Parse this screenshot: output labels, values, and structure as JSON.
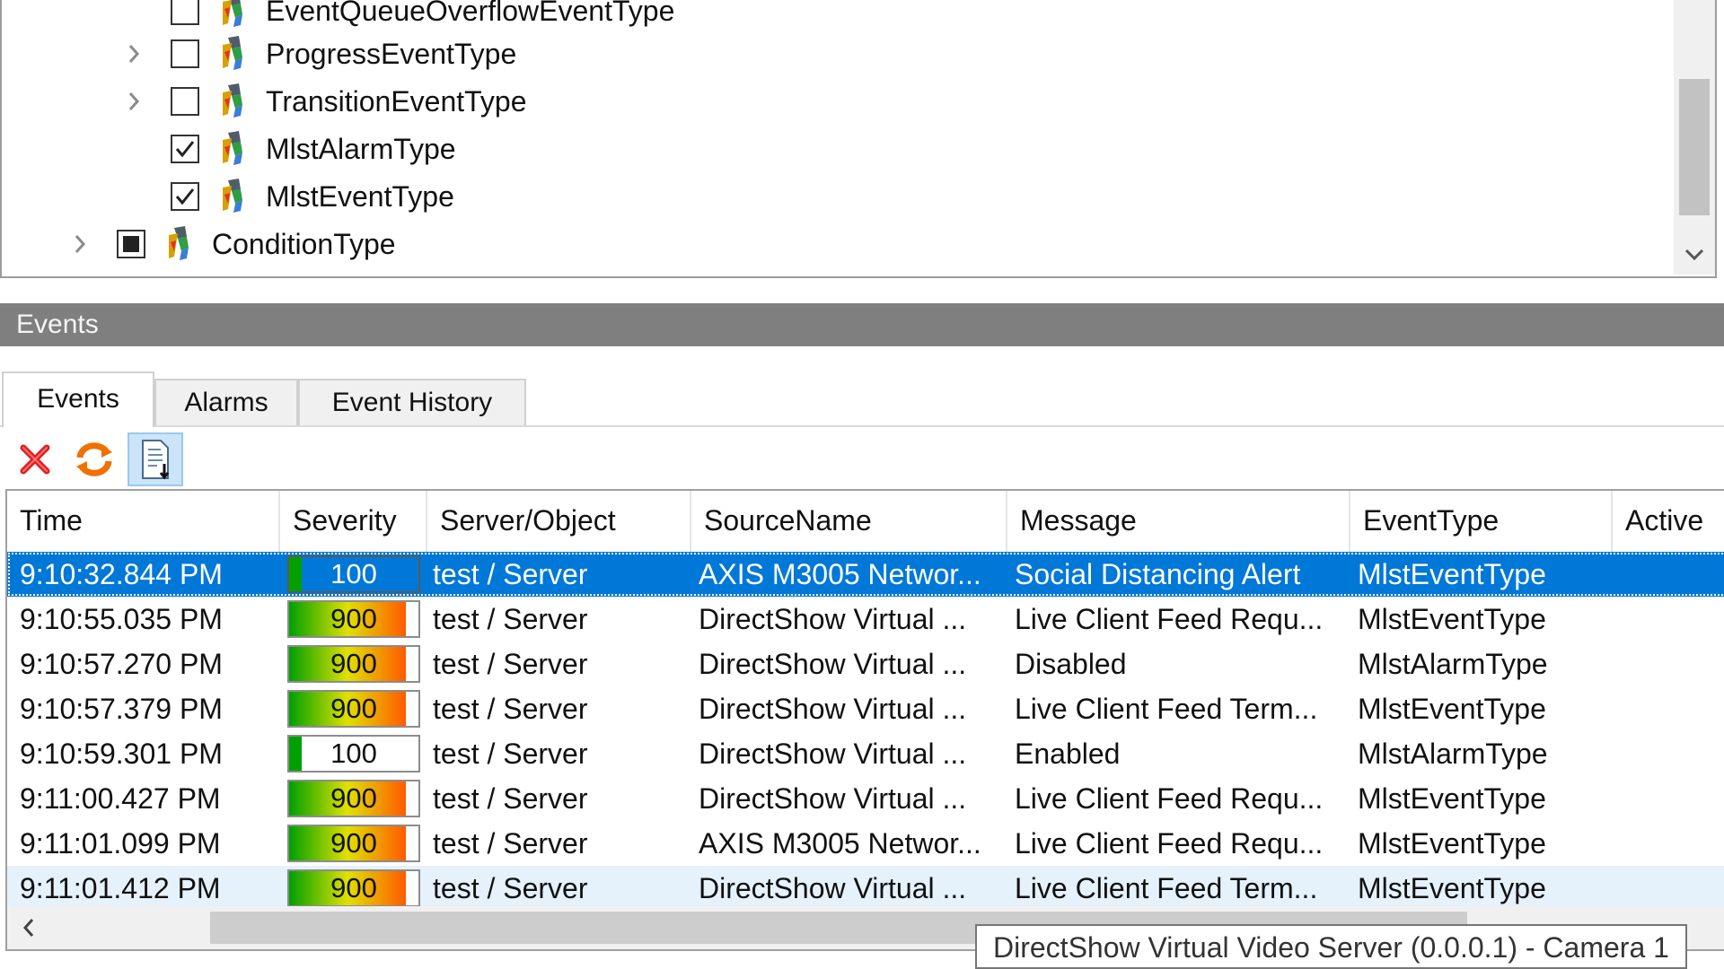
{
  "tree": {
    "items": [
      {
        "label": "EventQueueOverflowEventType",
        "checked": false,
        "expandable": false
      },
      {
        "label": "ProgressEventType",
        "checked": false,
        "expandable": true
      },
      {
        "label": "TransitionEventType",
        "checked": false,
        "expandable": true
      },
      {
        "label": "MlstAlarmType",
        "checked": true,
        "expandable": false
      },
      {
        "label": "MlstEventType",
        "checked": true,
        "expandable": false
      },
      {
        "label": "ConditionType",
        "checked": "partial",
        "expandable": true
      }
    ]
  },
  "events_panel": {
    "title": "Events",
    "tabs": [
      {
        "label": "Events",
        "active": true
      },
      {
        "label": "Alarms",
        "active": false
      },
      {
        "label": "Event History",
        "active": false
      }
    ],
    "toolbar": {
      "clear_icon": "clear-x-icon",
      "refresh_icon": "refresh-icon",
      "autoscroll_icon": "autoscroll-document-icon"
    }
  },
  "grid": {
    "columns": [
      "Time",
      "Severity",
      "Server/Object",
      "SourceName",
      "Message",
      "EventType",
      "Active"
    ],
    "rows": [
      {
        "time": "9:10:32.844 PM",
        "severity": "100",
        "severity_level": 0.1,
        "server": "test / Server",
        "source": "AXIS M3005 Networ...",
        "message": "Social Distancing Alert",
        "event_type": "MlstEventType",
        "active": "",
        "state": "selected"
      },
      {
        "time": "9:10:55.035 PM",
        "severity": "900",
        "severity_level": 0.9,
        "server": "test / Server",
        "source": "DirectShow Virtual ...",
        "message": "Live Client Feed Requ...",
        "event_type": "MlstEventType",
        "active": "",
        "state": "normal"
      },
      {
        "time": "9:10:57.270 PM",
        "severity": "900",
        "severity_level": 0.9,
        "server": "test / Server",
        "source": "DirectShow Virtual ...",
        "message": "Disabled",
        "event_type": "MlstAlarmType",
        "active": "",
        "state": "normal"
      },
      {
        "time": "9:10:57.379 PM",
        "severity": "900",
        "severity_level": 0.9,
        "server": "test / Server",
        "source": "DirectShow Virtual ...",
        "message": "Live Client Feed Term...",
        "event_type": "MlstEventType",
        "active": "",
        "state": "normal"
      },
      {
        "time": "9:10:59.301 PM",
        "severity": "100",
        "severity_level": 0.1,
        "server": "test / Server",
        "source": "DirectShow Virtual ...",
        "message": "Enabled",
        "event_type": "MlstAlarmType",
        "active": "",
        "state": "normal"
      },
      {
        "time": "9:11:00.427 PM",
        "severity": "900",
        "severity_level": 0.9,
        "server": "test / Server",
        "source": "DirectShow Virtual ...",
        "message": "Live Client Feed Requ...",
        "event_type": "MlstEventType",
        "active": "",
        "state": "normal"
      },
      {
        "time": "9:11:01.099 PM",
        "severity": "900",
        "severity_level": 0.9,
        "server": "test / Server",
        "source": "AXIS M3005 Networ...",
        "message": "Live Client Feed Requ...",
        "event_type": "MlstEventType",
        "active": "",
        "state": "normal"
      },
      {
        "time": "9:11:01.412 PM",
        "severity": "900",
        "severity_level": 0.9,
        "server": "test / Server",
        "source": "DirectShow Virtual ...",
        "message": "Live Client Feed Term...",
        "event_type": "MlstEventType",
        "active": "",
        "state": "hover"
      }
    ]
  },
  "tooltip": {
    "text": "DirectShow Virtual Video Server (0.0.0.1) - Camera 1"
  },
  "colors": {
    "selection": "#0078d7",
    "hover": "#e5f1fb",
    "header_bar": "#7f7f7f",
    "severity_low": "#00a000",
    "severity_mid": "#e0e000",
    "severity_high": "#ff5a00"
  }
}
